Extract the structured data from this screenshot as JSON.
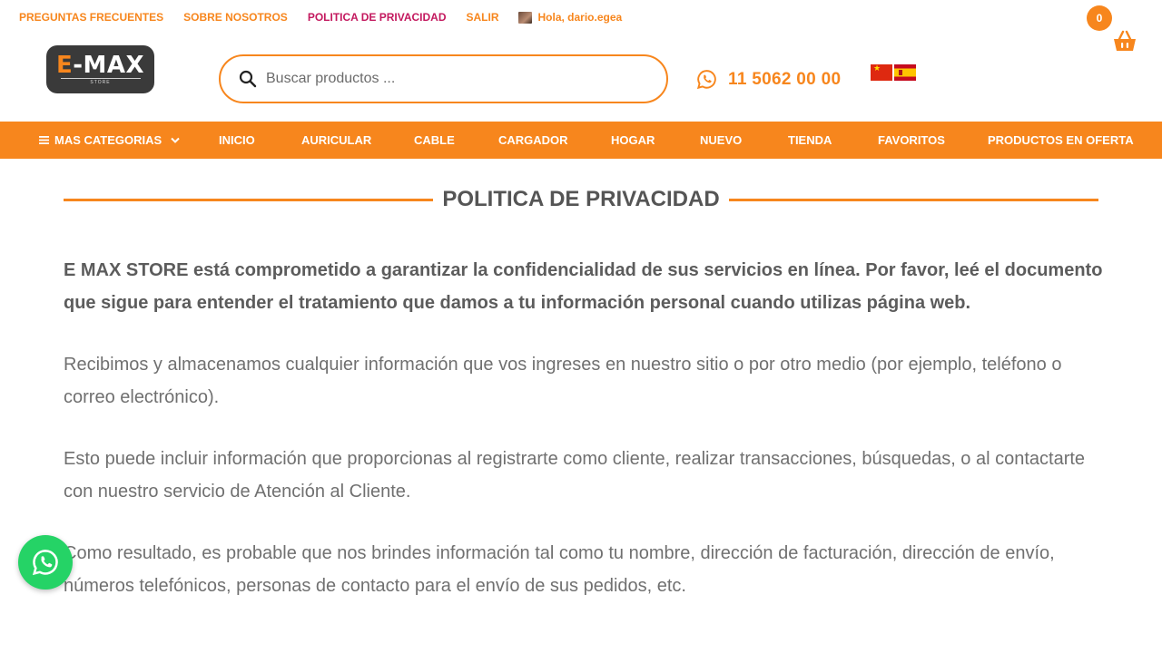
{
  "toplinks": {
    "faq": "PREGUNTAS FRECUENTES",
    "about": "SOBRE NOSOTROS",
    "privacy": "POLITICA DE PRIVACIDAD",
    "logout": "SALIR",
    "greeting": "Hola, dario.egea"
  },
  "logo": {
    "prefix": "E",
    "rest": "-MAX",
    "sub": "STORE"
  },
  "search": {
    "placeholder": "Buscar productos ..."
  },
  "phone": {
    "number": "11 5062 00 00",
    "icon": "whatsapp-icon"
  },
  "cart": {
    "count": "0",
    "icon": "basket-icon"
  },
  "nav": {
    "categories": "MAS CATEGORIAS",
    "items": [
      "INICIO",
      "AURICULAR",
      "CABLE",
      "CARGADOR",
      "HOGAR",
      "NUEVO",
      "TIENDA",
      "FAVORITOS",
      "PRODUCTOS EN OFERTA"
    ]
  },
  "page": {
    "title": "POLITICA DE PRIVACIDAD",
    "paragraphs": [
      "E MAX STORE está comprometido a garantizar la confidencialidad de sus servicios en línea. Por favor, leé el documento que sigue para entender el tratamiento que damos a tu información personal cuando utilizas página web.",
      "Recibimos y almacenamos cualquier información que vos ingreses en nuestro sitio o por otro medio (por ejemplo, teléfono o correo electrónico).",
      "Esto puede incluir información que proporcionas al registrarte como cliente, realizar transacciones, búsquedas, o al contactarte con nuestro servicio de Atención al Cliente.",
      "Como resultado, es probable que nos brindes información tal como tu nombre, dirección de facturación, dirección de envío, números telefónicos, personas de contacto para el envío de sus pedidos, etc."
    ]
  },
  "colors": {
    "accent": "#f7861d",
    "active_link": "#c3185e",
    "whatsapp": "#25d366"
  }
}
